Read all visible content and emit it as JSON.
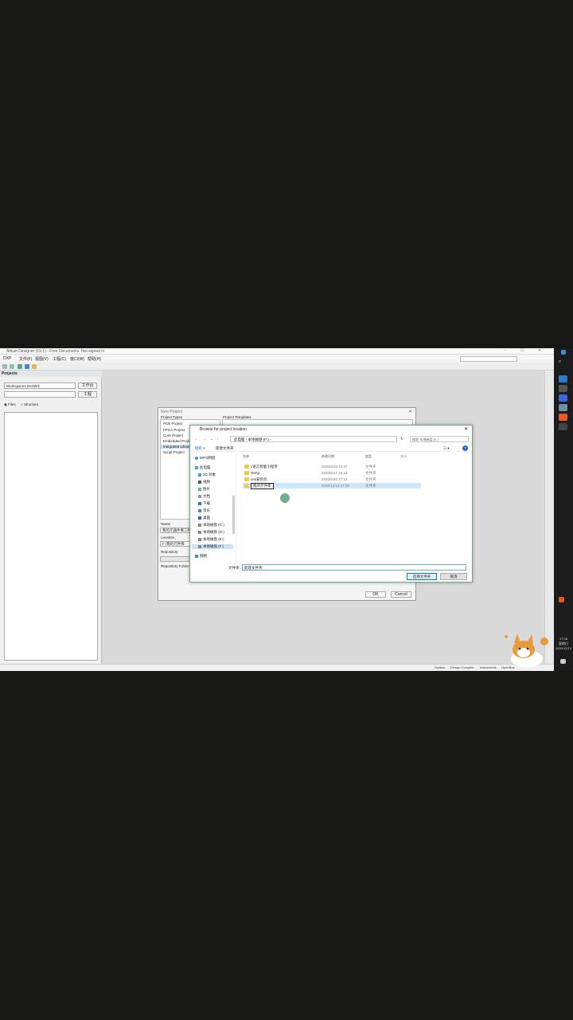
{
  "app": {
    "title": "Altium Designer (19.1) - Free Documents. Not signed in",
    "menu": [
      "DXP",
      "文件(F)",
      "视图(V)",
      "工程(C)",
      "窗口(W)",
      "帮助(H)"
    ]
  },
  "projects_panel": {
    "title": "Projects",
    "workspace": "Workspace1.DsnWrk",
    "workspace_btn": "工作台",
    "project_btn": "工程",
    "view_files": "Files",
    "view_structure": "Structure"
  },
  "new_project": {
    "title": "New Project",
    "project_types_label": "Project Types",
    "templates_label": "Project Templates",
    "project_types": [
      "PCB Project",
      "FPGA Project",
      "Core Project",
      "Embedded Project",
      "Integrated Library",
      "Script Project"
    ],
    "selected_type": "Integrated Library",
    "name_label": "Name",
    "name_value": "我的元器件库工程",
    "location_label": "Location",
    "location_value": "F:\\我的元件库",
    "repository_label": "Repository",
    "repo_folder_label": "Repository Folder",
    "ok": "OK",
    "cancel": "Cancel"
  },
  "browse": {
    "title": "Browse for project location",
    "breadcrumb": "此电脑 › 本地磁盘 (F:) ›",
    "search_placeholder": "搜索\"本地磁盘 (F:)\"",
    "organize": "组织 ▾",
    "new_folder": "新建文件夹",
    "nav": [
      "WPS网盘",
      "此电脑",
      "3D 对象",
      "视频",
      "图片",
      "文档",
      "下载",
      "音乐",
      "桌面",
      "本地磁盘 (C:)",
      "本地磁盘 (D:)",
      "本地磁盘 (E:)",
      "本地磁盘 (F:)",
      "网络"
    ],
    "nav_selected": "本地磁盘 (F:)",
    "columns": [
      "名称",
      "修改日期",
      "类型",
      "大小"
    ],
    "files": [
      {
        "name": "c语言智能小程序",
        "date": "2020/4/20 15:27",
        "type": "文件夹"
      },
      {
        "name": "Temp",
        "date": "2020/6/17 16:13",
        "type": "文件夹"
      },
      {
        "name": "vc6安装包",
        "date": "2020/5/30 17:19",
        "type": "文件夹"
      },
      {
        "name": "我的元件库",
        "date": "2020/12/13 17:06",
        "type": "文件夹"
      }
    ],
    "folder_label": "文件夹:",
    "folder_value": "新建文件夹",
    "select_btn": "选择文件夹",
    "cancel_btn": "取消"
  },
  "statusbar": [
    "System",
    "Design Compiler",
    "Instruments",
    "OpenBus"
  ],
  "clock": {
    "time": "17:06",
    "day": "星期日",
    "date": "2020/12/13"
  }
}
